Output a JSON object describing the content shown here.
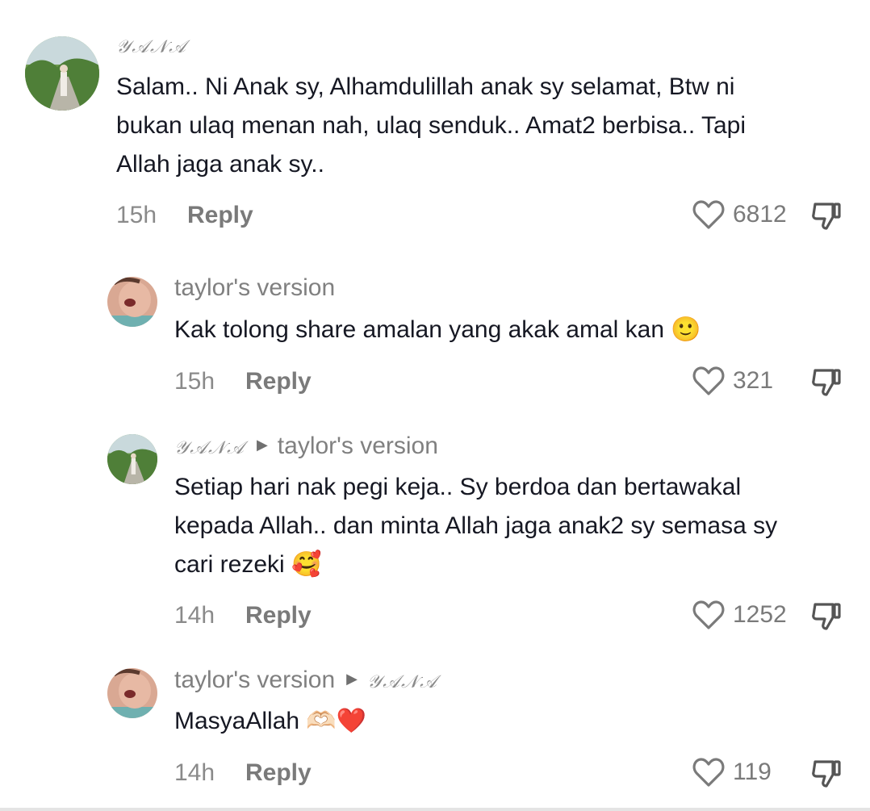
{
  "comments": [
    {
      "username": "𝒴𝒜𝒩𝒜",
      "reply_to": "",
      "text_lines": [
        "Salam.. Ni Anak sy, Alhamdulillah anak sy selamat, Btw ni",
        "bukan ulaq menan nah, ulaq senduk.. Amat2 berbisa.. Tapi",
        "Allah jaga anak sy.."
      ],
      "time": "15h",
      "reply_label": "Reply",
      "likes": "6812"
    },
    {
      "username": "taylor's version",
      "reply_to": "",
      "text_lines": [
        "Kak tolong share amalan yang akak amal kan 🙂"
      ],
      "time": "15h",
      "reply_label": "Reply",
      "likes": "321"
    },
    {
      "username": "𝒴𝒜𝒩𝒜",
      "reply_to": "taylor's version",
      "text_lines": [
        "Setiap hari nak pegi keja.. Sy berdoa dan bertawakal",
        "kepada Allah.. dan minta Allah jaga anak2 sy semasa sy",
        "cari rezeki 🥰"
      ],
      "time": "14h",
      "reply_label": "Reply",
      "likes": "1252"
    },
    {
      "username": "taylor's version",
      "reply_to": "𝒴𝒜𝒩𝒜",
      "text_lines": [
        "MasyaAllah 🫶🏻❤️"
      ],
      "time": "14h",
      "reply_label": "Reply",
      "likes": "119"
    }
  ],
  "icons": {
    "like": "heart-outline-icon",
    "dislike": "thumbs-down-icon",
    "reply_arrow": "triangle-right-icon"
  },
  "colors": {
    "text": "#161823",
    "muted": "#808080",
    "background": "#ffffff"
  }
}
